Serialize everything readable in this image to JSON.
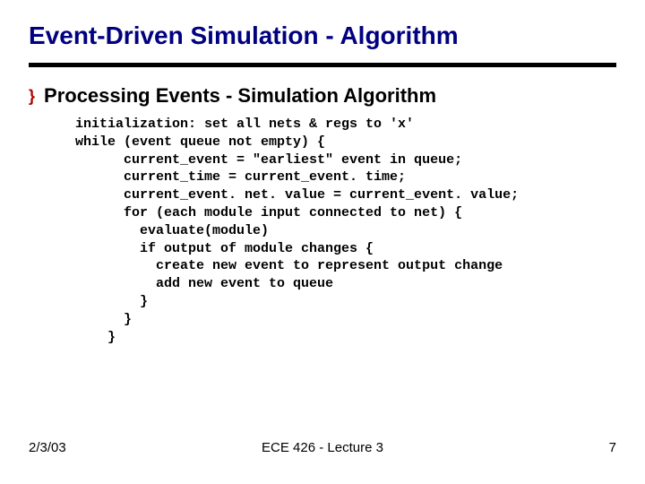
{
  "title": "Event-Driven Simulation - Algorithm",
  "bullet_glyph": "}",
  "section_title": "Processing Events - Simulation Algorithm",
  "code": "initialization: set all nets & regs to 'x'\nwhile (event queue not empty) {\n      current_event = \"earliest\" event in queue;\n      current_time = current_event. time;\n      current_event. net. value = current_event. value;\n      for (each module input connected to net) {\n        evaluate(module)\n        if output of module changes {\n          create new event to represent output change\n          add new event to queue\n        }\n      }\n    }",
  "footer": {
    "date": "2/3/03",
    "center": "ECE 426 - Lecture 3",
    "page": "7"
  }
}
